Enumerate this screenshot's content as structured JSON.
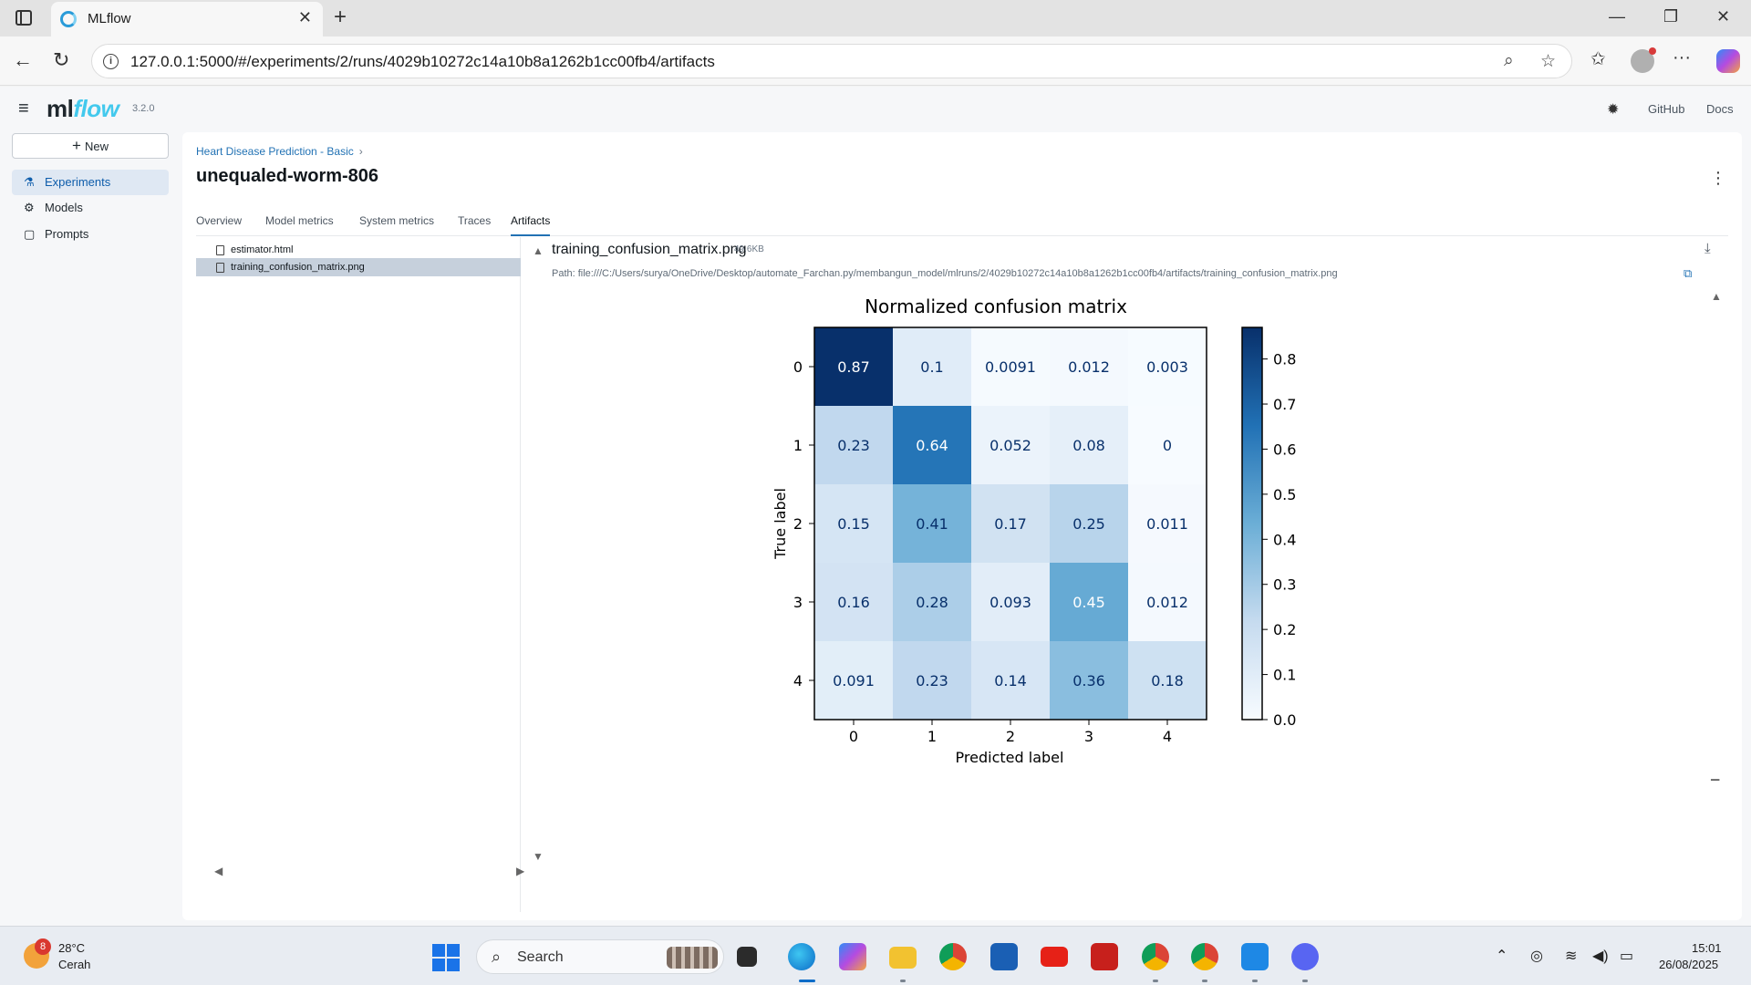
{
  "browser": {
    "tab_title": "MLflow",
    "tab_close": "✕",
    "new_tab": "+",
    "url": "127.0.0.1:5000/#/experiments/2/runs/4029b10272c14a10b8a1262b1cc00fb4/artifacts",
    "icons": [
      "tab-actions-icon",
      "back-icon",
      "reload-icon",
      "info-icon",
      "zoom-icon",
      "favorite-star-icon",
      "favorites-icon",
      "profile-icon",
      "more-icon",
      "copilot-icon"
    ]
  },
  "app": {
    "logo_ml": "ml",
    "logo_flow": "flow",
    "version": "3.2.0",
    "header_links": [
      "GitHub",
      "Docs"
    ],
    "brand_color": "#43c9ed",
    "accent_color": "#2272b4"
  },
  "sidebar": {
    "new_label": "New",
    "items": [
      {
        "label": "Experiments",
        "icon": "beaker-icon",
        "active": true
      },
      {
        "label": "Models",
        "icon": "models-icon",
        "active": false
      },
      {
        "label": "Prompts",
        "icon": "prompts-icon",
        "active": false
      }
    ]
  },
  "run": {
    "breadcrumb": "Heart Disease Prediction - Basic",
    "breadcrumb_sep": "›",
    "title": "unequaled-worm-806",
    "tabs": [
      "Overview",
      "Model metrics",
      "System metrics",
      "Traces",
      "Artifacts"
    ],
    "active_tab": "Artifacts"
  },
  "artifacts": {
    "files": [
      "estimator.html",
      "training_confusion_matrix.png"
    ],
    "selected": "training_confusion_matrix.png",
    "preview_name": "training_confusion_matrix.png",
    "preview_size": "49.6KB",
    "path": "Path: file:///C:/Users/surya/OneDrive/Desktop/automate_Farchan.py/membangun_model/mlruns/2/4029b10272c14a10b8a1262b1cc00fb4/artifacts/training_confusion_matrix.png"
  },
  "chart_data": {
    "type": "heatmap",
    "title": "Normalized confusion matrix",
    "xlabel": "Predicted label",
    "ylabel": "True label",
    "x_categories": [
      "0",
      "1",
      "2",
      "3",
      "4"
    ],
    "y_categories": [
      "0",
      "1",
      "2",
      "3",
      "4"
    ],
    "values": [
      [
        0.87,
        0.1,
        0.0091,
        0.012,
        0.003
      ],
      [
        0.23,
        0.64,
        0.052,
        0.08,
        0
      ],
      [
        0.15,
        0.41,
        0.17,
        0.25,
        0.011
      ],
      [
        0.16,
        0.28,
        0.093,
        0.45,
        0.012
      ],
      [
        0.091,
        0.23,
        0.14,
        0.36,
        0.18
      ]
    ],
    "labels": [
      [
        "0.87",
        "0.1",
        "0.0091",
        "0.012",
        "0.003"
      ],
      [
        "0.23",
        "0.64",
        "0.052",
        "0.08",
        "0"
      ],
      [
        "0.15",
        "0.41",
        "0.17",
        "0.25",
        "0.011"
      ],
      [
        "0.16",
        "0.28",
        "0.093",
        "0.45",
        "0.012"
      ],
      [
        "0.091",
        "0.23",
        "0.14",
        "0.36",
        "0.18"
      ]
    ],
    "colormap": "Blues",
    "colorbar_range": [
      0,
      0.87
    ],
    "colorbar_ticks": [
      "0.0",
      "0.1",
      "0.2",
      "0.3",
      "0.4",
      "0.5",
      "0.6",
      "0.7",
      "0.8"
    ]
  },
  "taskbar": {
    "weather_badge": "8",
    "temperature": "28°C",
    "weather": "Cerah",
    "search_label": "Search",
    "time": "15:01",
    "date": "26/08/2025",
    "apps": [
      "task-view-icon",
      "edge-icon",
      "copilot-app-icon",
      "file-explorer-icon",
      "chrome-icon",
      "store-icon",
      "youtube-icon",
      "acrobat-icon",
      "chrome-profile-f-icon",
      "chrome-profile-2-icon",
      "vscode-icon",
      "discord-icon"
    ]
  }
}
